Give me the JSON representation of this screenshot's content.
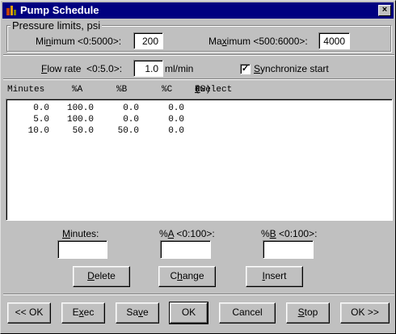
{
  "window": {
    "title": "Pump Schedule",
    "close_label": "×"
  },
  "pressure": {
    "group_label": "Pressure limits, psi",
    "minimum": {
      "label_before": "Mi",
      "label_key": "n",
      "label_after": "imum <0:5000>:",
      "value": "200"
    },
    "maximum": {
      "label_before": "Ma",
      "label_key": "x",
      "label_after": "imum <500:6000>:",
      "value": "4000"
    }
  },
  "flow": {
    "label_key": "F",
    "label_after": "low rate  <0:5.0>:",
    "value": "1.0",
    "unit": "ml/min"
  },
  "sync": {
    "label_key": "S",
    "label_after": "ynchronize start",
    "checked_glyph": "✓"
  },
  "table": {
    "headers": {
      "minutes": "Minutes",
      "a": "%A",
      "b": "%B",
      "c": "%C",
      "select_before": "(Select ",
      "select_key": "R",
      "select_after": "ow)"
    },
    "rows": [
      {
        "minutes": "0.0",
        "a": "100.0",
        "b": "0.0",
        "c": "0.0"
      },
      {
        "minutes": "5.0",
        "a": "100.0",
        "b": "0.0",
        "c": "0.0"
      },
      {
        "minutes": "10.0",
        "a": "50.0",
        "b": "50.0",
        "c": "0.0"
      }
    ]
  },
  "edit": {
    "minutes_key": "M",
    "minutes_after": "inutes:",
    "a_before": "%",
    "a_key": "A",
    "a_after": " <0:100>:",
    "b_before": "%",
    "b_key": "B",
    "b_after": " <0:100>:",
    "minutes_value": "",
    "a_value": "",
    "b_value": ""
  },
  "actions": {
    "delete_key": "D",
    "delete_after": "elete",
    "change_before": "C",
    "change_key": "h",
    "change_after": "ange",
    "insert_key": "I",
    "insert_after": "nsert"
  },
  "footer": {
    "back": "<< OK",
    "exec_before": "E",
    "exec_key": "x",
    "exec_after": "ec",
    "save_before": "Sa",
    "save_key": "v",
    "save_after": "e",
    "ok": "OK",
    "cancel": "Cancel",
    "stop_key": "S",
    "stop_after": "top",
    "next": "OK >>"
  }
}
